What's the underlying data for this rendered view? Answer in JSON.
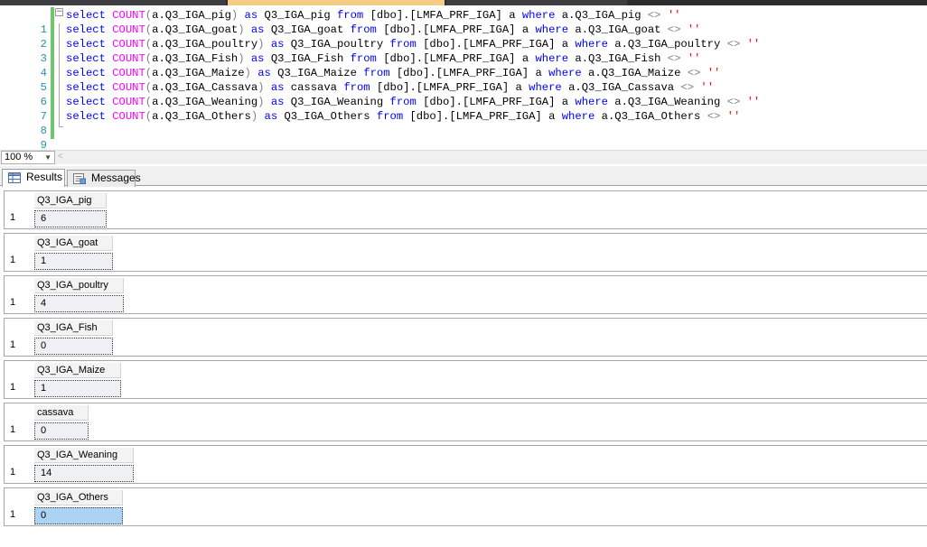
{
  "editor": {
    "lines": [
      {
        "num": "1",
        "col": "a.Q3_IGA_pig",
        "alias": "Q3_IGA_pig"
      },
      {
        "num": "2",
        "col": "a.Q3_IGA_goat",
        "alias": "Q3_IGA_goat"
      },
      {
        "num": "3",
        "col": "a.Q3_IGA_poultry",
        "alias": "Q3_IGA_poultry"
      },
      {
        "num": "4",
        "col": "a.Q3_IGA_Fish",
        "alias": "Q3_IGA_Fish"
      },
      {
        "num": "5",
        "col": "a.Q3_IGA_Maize",
        "alias": "Q3_IGA_Maize"
      },
      {
        "num": "6",
        "col": "a.Q3_IGA_Cassava",
        "alias": "cassava"
      },
      {
        "num": "7",
        "col": "a.Q3_IGA_Weaning",
        "alias": "Q3_IGA_Weaning"
      },
      {
        "num": "8",
        "col": "a.Q3_IGA_Others",
        "alias": "Q3_IGA_Others"
      }
    ],
    "empty_line_num": "9",
    "kw_select": "select",
    "fn_count": "COUNT",
    "kw_as": "as",
    "kw_from": "from",
    "table": "[dbo].[LMFA_PRF_IGA]",
    "alias_a": "a",
    "kw_where": "where",
    "op_ne": "<>",
    "empty_str": "''",
    "colors": {
      "keyword": "#0000ff",
      "function": "#ff00ff",
      "operator": "#808080",
      "string": "#ff0000",
      "line_number": "#2b91af"
    }
  },
  "zoom": {
    "value": "100 %"
  },
  "tabs": {
    "results": "Results",
    "messages": "Messages"
  },
  "results": [
    {
      "header": "Q3_IGA_pig",
      "row": "1",
      "value": "6",
      "selected": false
    },
    {
      "header": "Q3_IGA_goat",
      "row": "1",
      "value": "1",
      "selected": false
    },
    {
      "header": "Q3_IGA_poultry",
      "row": "1",
      "value": "4",
      "selected": false
    },
    {
      "header": "Q3_IGA_Fish",
      "row": "1",
      "value": "0",
      "selected": false
    },
    {
      "header": "Q3_IGA_Maize",
      "row": "1",
      "value": "1",
      "selected": false
    },
    {
      "header": "cassava",
      "row": "1",
      "value": "0",
      "selected": false
    },
    {
      "header": "Q3_IGA_Weaning",
      "row": "1",
      "value": "14",
      "selected": false
    },
    {
      "header": "Q3_IGA_Others",
      "row": "1",
      "value": "0",
      "selected": true
    }
  ]
}
